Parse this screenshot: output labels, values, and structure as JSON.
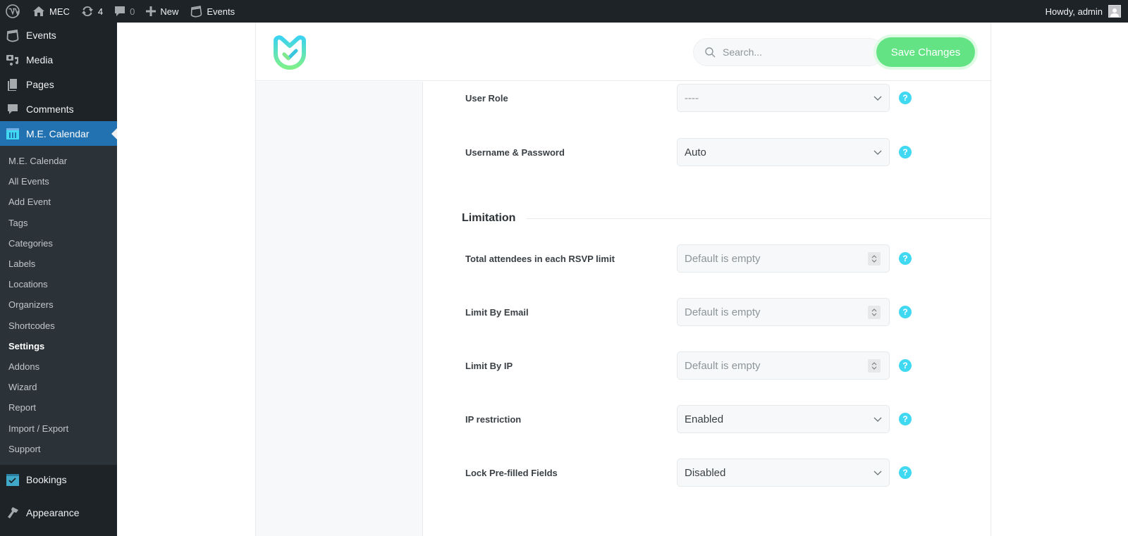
{
  "adminbar": {
    "site_name": "MEC",
    "updates_count": "4",
    "comments_count": "0",
    "new_label": "New",
    "events_label": "Events",
    "greeting": "Howdy, admin"
  },
  "sidebar": {
    "top_items": [
      {
        "label": "Events",
        "icon": "events-calendar-icon"
      },
      {
        "label": "Media",
        "icon": "media-icon"
      },
      {
        "label": "Pages",
        "icon": "pages-icon"
      },
      {
        "label": "Comments",
        "icon": "comments-icon"
      },
      {
        "label": "M.E. Calendar",
        "icon": "me-calendar-icon",
        "current": true
      }
    ],
    "submenu": [
      {
        "label": "M.E. Calendar"
      },
      {
        "label": "All Events"
      },
      {
        "label": "Add Event"
      },
      {
        "label": "Tags"
      },
      {
        "label": "Categories"
      },
      {
        "label": "Labels"
      },
      {
        "label": "Locations"
      },
      {
        "label": "Organizers"
      },
      {
        "label": "Shortcodes"
      },
      {
        "label": "Settings",
        "current": true
      },
      {
        "label": "Addons"
      },
      {
        "label": "Wizard"
      },
      {
        "label": "Report"
      },
      {
        "label": "Import / Export"
      },
      {
        "label": "Support"
      }
    ],
    "bottom_items": [
      {
        "label": "Bookings",
        "icon": "bookings-icon"
      },
      {
        "label": "Appearance",
        "icon": "appearance-icon"
      }
    ]
  },
  "header": {
    "search_placeholder": "Search...",
    "save_label": "Save Changes"
  },
  "form": {
    "user_role": {
      "label": "User Role",
      "value": "----"
    },
    "username_password": {
      "label": "Username & Password",
      "value": "Auto"
    },
    "limitation_title": "Limitation",
    "total_attendees": {
      "label": "Total attendees in each RSVP limit",
      "placeholder": "Default is empty"
    },
    "limit_email": {
      "label": "Limit By Email",
      "placeholder": "Default is empty"
    },
    "limit_ip": {
      "label": "Limit By IP",
      "placeholder": "Default is empty"
    },
    "ip_restriction": {
      "label": "IP restriction",
      "value": "Enabled"
    },
    "lock_prefilled": {
      "label": "Lock Pre-filled Fields",
      "value": "Disabled"
    },
    "help_glyph": "?"
  },
  "colors": {
    "accent_blue": "#2271b1",
    "save_green": "#64e385",
    "help_cyan": "#40d9f1",
    "admin_dark": "#1d2327"
  }
}
